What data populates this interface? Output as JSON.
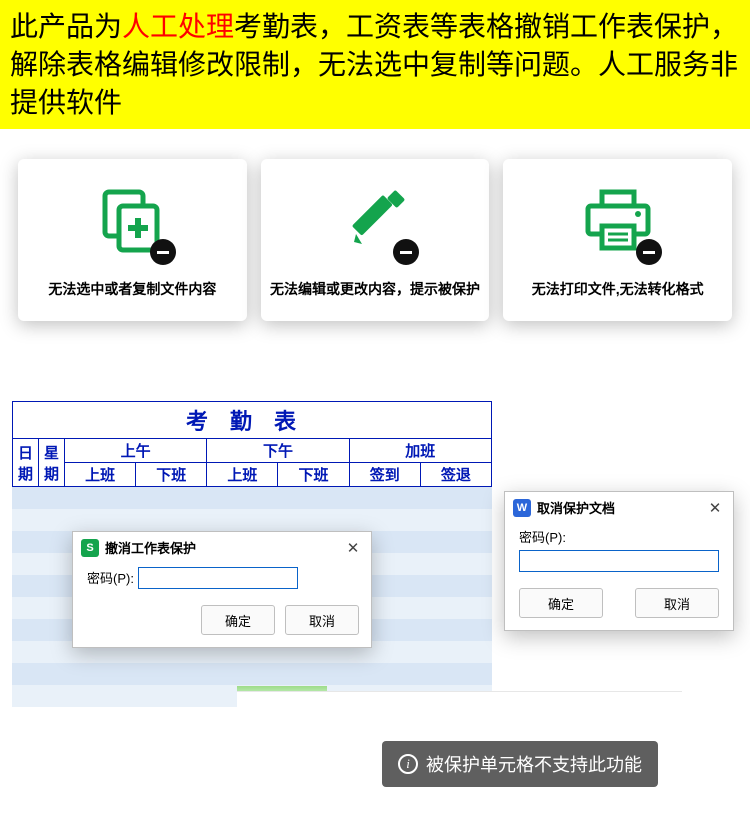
{
  "banner": {
    "part1": "此产品为",
    "highlight": "人工处理",
    "part2": "考勤表，工资表等表格撤销工作表保护，解除表格编辑修改限制，无法选中复制等问题。人工服务非提供软件"
  },
  "cards": [
    {
      "label": "无法选中或者复制文件内容",
      "icon": "copy-plus-icon"
    },
    {
      "label": "无法编辑或更改内容，提示被保护",
      "icon": "pencil-icon"
    },
    {
      "label": "无法打印文件,无法转化格式",
      "icon": "printer-icon"
    }
  ],
  "sheet": {
    "title": "考勤表",
    "cols_left": [
      "日期",
      "星期"
    ],
    "sections": [
      "上午",
      "下午",
      "加班"
    ],
    "subcols": [
      "上班",
      "下班",
      "上班",
      "下班",
      "签到",
      "签退"
    ]
  },
  "dialog_s": {
    "badge": "S",
    "title": "撤消工作表保护",
    "pwd_label": "密码(P):",
    "btn_ok": "确定",
    "btn_cancel": "取消",
    "close": "✕"
  },
  "dialog_w": {
    "badge": "W",
    "title": "取消保护文档",
    "pwd_label": "密码(P):",
    "btn_ok": "确定",
    "btn_cancel": "取消",
    "close": "✕"
  },
  "toast": {
    "text": "被保护单元格不支持此功能"
  }
}
